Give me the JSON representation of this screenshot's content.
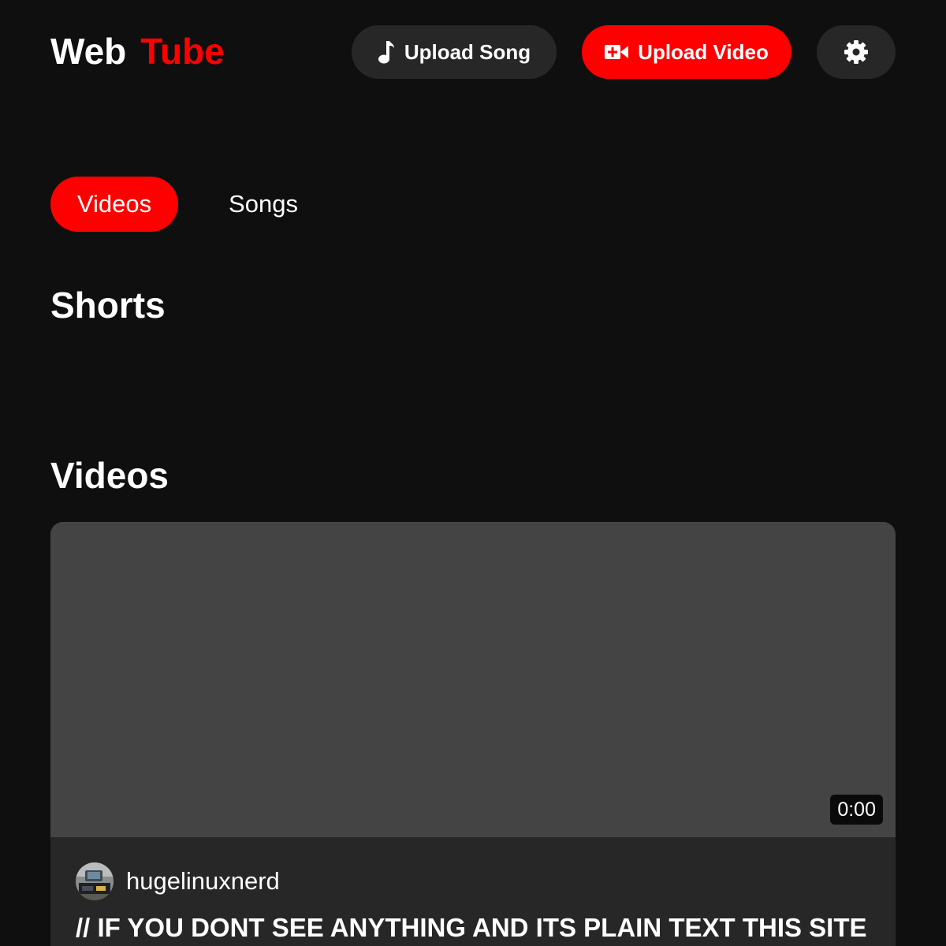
{
  "header": {
    "logo_part1": "Web",
    "logo_part2": "Tube",
    "upload_song_label": "Upload Song",
    "upload_video_label": "Upload Video",
    "song_icon": "music-note-icon",
    "video_icon": "video-plus-icon",
    "settings_icon": "gear-icon"
  },
  "tabs": [
    {
      "label": "Videos",
      "active": true
    },
    {
      "label": "Songs",
      "active": false
    }
  ],
  "sections": {
    "shorts_title": "Shorts",
    "videos_title": "Videos"
  },
  "videos": [
    {
      "duration": "0:00",
      "channel": "hugelinuxnerd",
      "title": "// IF YOU DONT SEE ANYTHING AND ITS PLAIN TEXT THIS SITE"
    }
  ],
  "colors": {
    "background": "#0f0f0f",
    "accent": "#ff0000",
    "button_dark": "#272727",
    "thumbnail": "#444444"
  }
}
